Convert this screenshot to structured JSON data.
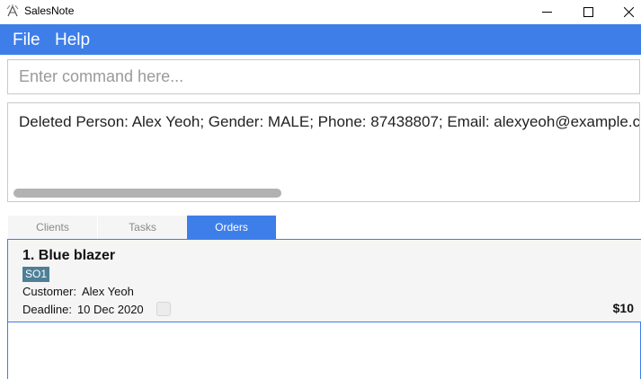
{
  "window": {
    "title": "SalesNote",
    "icon": "salesnote-app-icon",
    "controls": [
      "minimize-icon",
      "maximize-icon",
      "close-icon"
    ]
  },
  "menu": {
    "file": "File",
    "help": "Help"
  },
  "command": {
    "placeholder": "Enter command here...",
    "value": ""
  },
  "result": {
    "text": "Deleted Person: Alex Yeoh; Gender: MALE; Phone: 87438807; Email: alexyeoh@example.c"
  },
  "tabs": [
    {
      "label": "Clients",
      "selected": false
    },
    {
      "label": "Tasks",
      "selected": false
    },
    {
      "label": "Orders",
      "selected": true
    }
  ],
  "orders": [
    {
      "title": "1. Blue blazer",
      "tag": "SO1",
      "customer_label": "Customer:",
      "customer": "Alex Yeoh",
      "deadline_label": "Deadline:",
      "deadline": "10 Dec 2020",
      "done": false,
      "price": "$10"
    }
  ],
  "colors": {
    "accent": "#3e7ee9",
    "tag": "#4e7f97",
    "card_bg": "#f5f5f5"
  }
}
